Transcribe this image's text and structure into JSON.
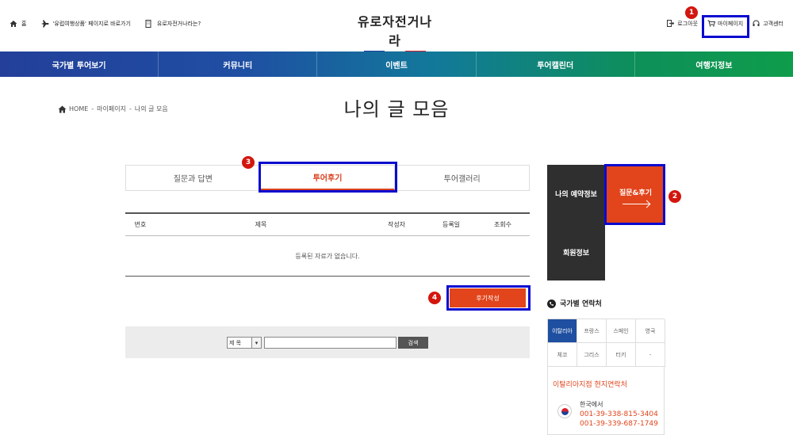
{
  "topbar": {
    "home_label": "홈",
    "shortcut_label": "'유럽여행상품' 페이지로 바로가기",
    "about_label": "유로자전거나라는?",
    "logout_label": "로그아웃",
    "mypage_label": "마이페이지",
    "support_label": "고객센터"
  },
  "logo": {
    "text": "유로자전거나라",
    "colors": [
      "#1e3f99",
      "#ffffff",
      "#d6202e"
    ]
  },
  "nav": {
    "items": [
      "국가별 투어보기",
      "커뮤니티",
      "이벤트",
      "투어캘린더",
      "여행지정보"
    ]
  },
  "breadcrumb": {
    "home": "HOME",
    "sep1": "-",
    "level1": "마이페이지",
    "sep2": "-",
    "level2": "나의 글 모음"
  },
  "page": {
    "title": "나의 글 모음"
  },
  "tabs": {
    "items": [
      "질문과 답변",
      "투어후기",
      "투어갤러리"
    ],
    "active_index": 1
  },
  "table": {
    "headers": [
      "번호",
      "제목",
      "작성자",
      "등록일",
      "조회수"
    ],
    "empty_message": "등록된 자료가 없습니다."
  },
  "write_button": "후기작성",
  "search": {
    "select_value": "제 목",
    "button_label": "검색"
  },
  "side": {
    "reservation": "나의 예약정보",
    "qa_review": "질문&후기",
    "member_info": "회원정보"
  },
  "contact": {
    "heading": "국가별 연락처",
    "countries": [
      "이탈리아",
      "프랑스",
      "스페인",
      "영국",
      "체코",
      "그리스",
      "터키",
      "-"
    ],
    "active_country_index": 0,
    "branch_title": "이탈리아지점 현지연락처",
    "from_korea": "한국에서",
    "phone1": "001-39-338-815-3404",
    "phone2": "001-39-339-687-1749"
  },
  "annotations": {
    "markers": [
      "1",
      "2",
      "3",
      "4"
    ],
    "highlight_color": "#0a0ad0",
    "marker_color": "#d3160e"
  },
  "colors": {
    "accent": "#e2441b",
    "nav_start": "#233f99",
    "nav_end": "#0e9d4b",
    "dark_panel": "#2f2f2f",
    "active_country": "#1e4fa0"
  }
}
